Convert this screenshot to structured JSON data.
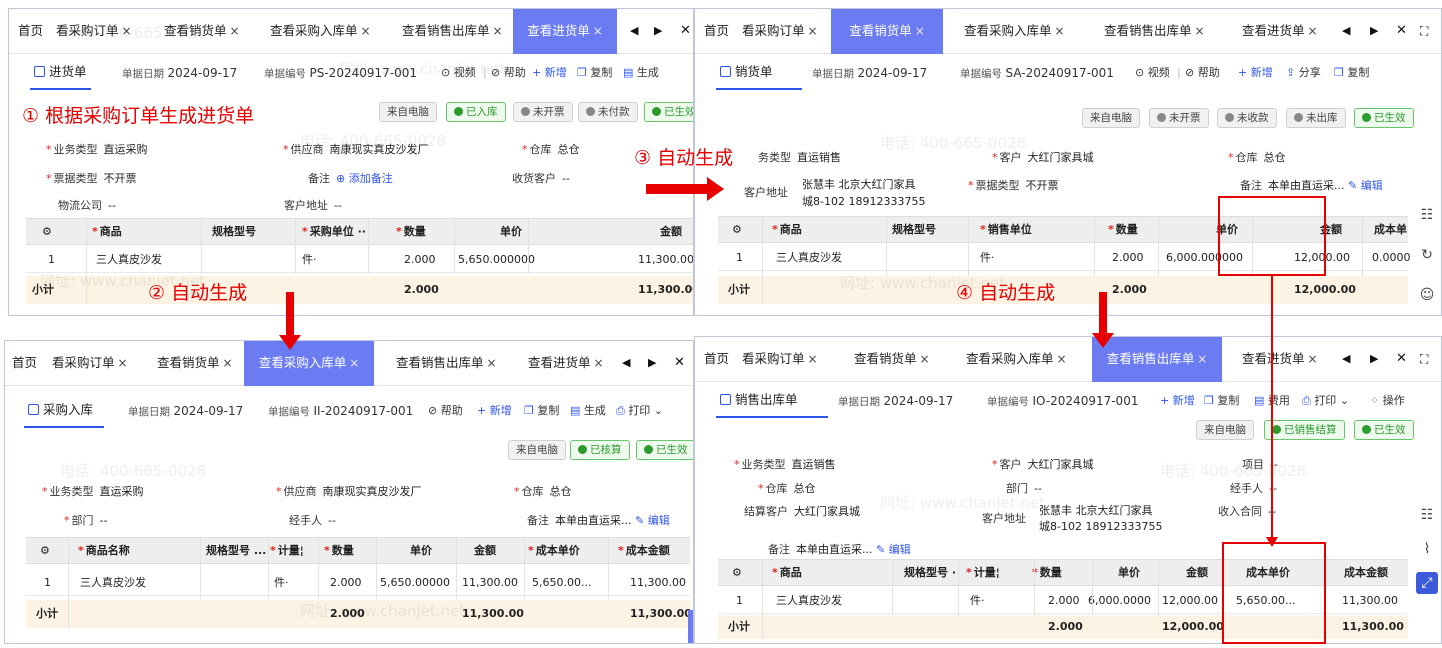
{
  "panel_tl": {
    "tabs": [
      {
        "label": "首页",
        "closable": false
      },
      {
        "label": "看采购订单",
        "closable": true
      },
      {
        "label": "查看销货单",
        "closable": true
      },
      {
        "label": "查看采购入库单",
        "closable": true
      },
      {
        "label": "查看销售出库单",
        "closable": true
      },
      {
        "label": "查看进货单",
        "closable": true,
        "active": true
      }
    ],
    "close_glyph": "×",
    "doc_title": "进货单",
    "date_label": "单据日期",
    "date": "2024-09-17",
    "no_label": "单据编号",
    "no": "PS-20240917-001",
    "video": "⊙ 视频",
    "help": "⊘ 帮助",
    "add": "+ 新增",
    "copy": "复制",
    "gen": "生成",
    "badges": [
      "来自电脑",
      "已入库",
      "未开票",
      "未付款",
      "已生效"
    ],
    "fields": {
      "biz_type_k": "业务类型",
      "biz_type_v": "直运采购",
      "supplier_k": "供应商",
      "supplier_v": "南康现实真皮沙发厂",
      "wh_k": "仓库",
      "wh_v": "总仓",
      "ticket_k": "票据类型",
      "ticket_v": "不开票",
      "remark_k": "备注",
      "remark_v": "添加备注",
      "recv_k": "收货客户",
      "recv_v": "--",
      "logi_k": "物流公司",
      "logi_v": "--",
      "addr_k": "客户地址",
      "addr_v": "--"
    },
    "cols": [
      "商品",
      "规格型号",
      "采购单位 ··",
      "数量",
      "单价",
      "金额"
    ],
    "row": {
      "idx": "1",
      "name": "三人真皮沙发",
      "unit": "件·",
      "qty": "2.000",
      "price": "5,650.000000",
      "amount": "11,300.00"
    },
    "subtotal": {
      "label": "小计",
      "qty": "2.000",
      "amount": "11,300.00"
    }
  },
  "panel_tr": {
    "tabs": [
      {
        "label": "首页",
        "closable": false
      },
      {
        "label": "看采购订单",
        "closable": true
      },
      {
        "label": "查看销货单",
        "closable": true,
        "active": true
      },
      {
        "label": "查看采购入库单",
        "closable": true
      },
      {
        "label": "查看销售出库单",
        "closable": true
      },
      {
        "label": "查看进货单",
        "closable": true
      }
    ],
    "doc_title": "销货单",
    "date_label": "单据日期",
    "date": "2024-09-17",
    "no_label": "单据编号",
    "no": "SA-20240917-001",
    "video": "⊙ 视频",
    "help": "⊘ 帮助",
    "add": "+ 新增",
    "share": "分享",
    "copy": "复制",
    "badges": [
      "来自电脑",
      "未开票",
      "未收款",
      "未出库",
      "已生效"
    ],
    "fields": {
      "biz_type_k": "务类型",
      "biz_type_v": "直运销售",
      "cust_k": "客户",
      "cust_v": "大红门家具城",
      "wh_k": "仓库",
      "wh_v": "总仓",
      "addr_k": "客户地址",
      "addr_v1": "张慧丰 北京大红门家具",
      "addr_v2": "城8-102 18912333755",
      "ticket_k": "票据类型",
      "ticket_v": "不开票",
      "remark_k": "备注",
      "remark_v": "本单由直运采...",
      "edit": "编辑"
    },
    "cols": [
      "商品",
      "规格型号",
      "销售单位",
      "数量",
      "单价",
      "金额",
      "成本单"
    ],
    "row": {
      "idx": "1",
      "name": "三人真皮沙发",
      "unit": "件·",
      "qty": "2.000",
      "price": "6,000.000000",
      "amount": "12,000.00",
      "cost": "0.0000"
    },
    "subtotal": {
      "label": "小计",
      "qty": "2.000",
      "amount": "12,000.00"
    }
  },
  "panel_bl": {
    "tabs": [
      {
        "label": "首页",
        "closable": false
      },
      {
        "label": "看采购订单",
        "closable": true
      },
      {
        "label": "查看销货单",
        "closable": true
      },
      {
        "label": "查看采购入库单",
        "closable": true,
        "active": true
      },
      {
        "label": "查看销售出库单",
        "closable": true
      },
      {
        "label": "查看进货单",
        "closable": true
      }
    ],
    "doc_title": "采购入库",
    "date_label": "单据日期",
    "date": "2024-09-17",
    "no_label": "单据编号",
    "no": "II-20240917-001",
    "help": "⊘ 帮助",
    "add": "+ 新增",
    "copy": "复制",
    "gen": "生成",
    "print": "打印",
    "badges": [
      "来自电脑",
      "已核算",
      "已生效"
    ],
    "fields": {
      "biz_type_k": "业务类型",
      "biz_type_v": "直运采购",
      "supplier_k": "供应商",
      "supplier_v": "南康现实真皮沙发厂",
      "wh_k": "仓库",
      "wh_v": "总仓",
      "dept_k": "部门",
      "dept_v": "--",
      "handler_k": "经手人",
      "handler_v": "--",
      "remark_k": "备注",
      "remark_v": "本单由直运采...",
      "edit": "编辑"
    },
    "cols": [
      "商品名称",
      "规格型号 ...",
      "计量¦",
      "数量",
      "单价",
      "金额",
      "成本单价",
      "成本金额"
    ],
    "row": {
      "idx": "1",
      "name": "三人真皮沙发",
      "unit": "件·",
      "qty": "2.000",
      "price": "5,650.00000",
      "amount": "11,300.00",
      "cost": "5,650.00...",
      "cost_amt": "11,300.00"
    },
    "subtotal": {
      "label": "小计",
      "qty": "2.000",
      "amount": "11,300.00",
      "cost_amt": "11,300.00"
    }
  },
  "panel_br": {
    "tabs": [
      {
        "label": "首页",
        "closable": false
      },
      {
        "label": "看采购订单",
        "closable": true
      },
      {
        "label": "查看销货单",
        "closable": true
      },
      {
        "label": "查看采购入库单",
        "closable": true
      },
      {
        "label": "查看销售出库单",
        "closable": true,
        "active": true
      },
      {
        "label": "查看进货单",
        "closable": true
      }
    ],
    "doc_title": "销售出库单",
    "date_label": "单据日期",
    "date": "2024-09-17",
    "no_label": "单据编号",
    "no": "IO-20240917-001",
    "add": "+ 新增",
    "copy": "复制",
    "fee": "费用",
    "print": "打印",
    "ops": "操作",
    "badges": [
      "来自电脑",
      "已销售结算",
      "已生效"
    ],
    "fields": {
      "biz_type_k": "业务类型",
      "biz_type_v": "直运销售",
      "cust_k": "客户",
      "cust_v": "大红门家具城",
      "proj_k": "项目",
      "proj_v": "--",
      "wh_k": "仓库",
      "wh_v": "总仓",
      "dept_k": "部门",
      "dept_v": "--",
      "handler_k": "经手人",
      "handler_v": "--",
      "settle_k": "结算客户",
      "settle_v": "大红门家具城",
      "addr_k": "客户地址",
      "addr_v1": "张慧丰 北京大红门家具",
      "addr_v2": "城8-102 18912333755",
      "contract_k": "收入合同",
      "contract_v": "--",
      "remark_k": "备注",
      "remark_v": "本单由直运采...",
      "edit": "编辑"
    },
    "cols": [
      "商品",
      "规格型号 ·",
      "计量¦",
      "数量",
      "单价",
      "金额",
      "成本单价",
      "成本金额"
    ],
    "row": {
      "idx": "1",
      "name": "三人真皮沙发",
      "unit": "件·",
      "qty": "2.000",
      "price": "6,000.0000",
      "amount": "12,000.00",
      "cost": "5,650.00...",
      "cost_amt": "11,300.00"
    },
    "subtotal": {
      "label": "小计",
      "qty": "2.000",
      "amount": "12,000.00",
      "cost_amt": "11,300.00"
    }
  },
  "annotations": {
    "a1": "① 根据采购订单生成进货单",
    "a2": "② 自动生成",
    "a3": "③ 自动生成",
    "a4": "④ 自动生成"
  },
  "watermark": {
    "phone": "电话: 400-665-0028",
    "site": "网址: www.chanjet.net"
  },
  "nav": {
    "prev": "◀",
    "next": "▶",
    "close": "✕",
    "expand": "⛶"
  },
  "colors": {
    "accent": "#2f54eb",
    "active_tab": "#6b7cf2",
    "annotation": "#e60000",
    "subtotal_bg": "#fcf3e4",
    "green": "#2d9a2d"
  }
}
